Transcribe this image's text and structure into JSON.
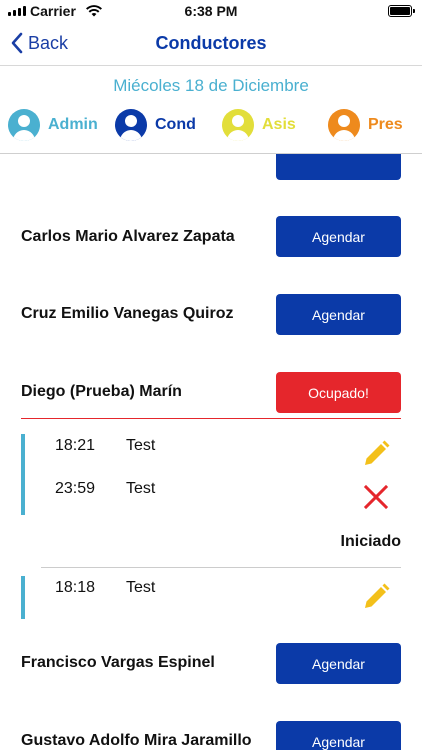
{
  "status_bar": {
    "carrier": "Carrier",
    "time": "6:38 PM"
  },
  "nav": {
    "back_label": "Back",
    "title": "Conductores"
  },
  "date": "Miécoles 18 de Diciembre",
  "roles": [
    {
      "label": "Admin",
      "color": "#4ab0d0"
    },
    {
      "label": "Cond",
      "color": "#0b3aa8"
    },
    {
      "label": "Asis",
      "color": "#e2de3a"
    },
    {
      "label": "Pres",
      "color": "#ee8a1d"
    }
  ],
  "drivers": [
    {
      "name": "Carlos Mario  Alvarez Zapata",
      "button": "Agendar"
    },
    {
      "name": "Cruz Emilio Vanegas Quiroz",
      "button": "Agendar"
    },
    {
      "name": "Diego (Prueba) Marín",
      "button": "Ocupado!"
    },
    {
      "name": "Francisco Vargas Espinel",
      "button": "Agendar"
    },
    {
      "name": "Gustavo Adolfo Mira Jaramillo",
      "button": "Agendar"
    }
  ],
  "tasks_group_1": [
    {
      "time": "18:21",
      "name": "Test",
      "action_icon": "pencil-icon"
    },
    {
      "time": "23:59",
      "name": "Test",
      "action_icon": "close-icon"
    }
  ],
  "group_1_status": "Iniciado",
  "tasks_group_2": [
    {
      "time": "18:18",
      "name": "Test",
      "action_icon": "pencil-icon"
    }
  ],
  "colors": {
    "primary": "#0b3aa8",
    "danger": "#e5262c",
    "accent": "#4ab0d0",
    "edit": "#f3c01a"
  }
}
